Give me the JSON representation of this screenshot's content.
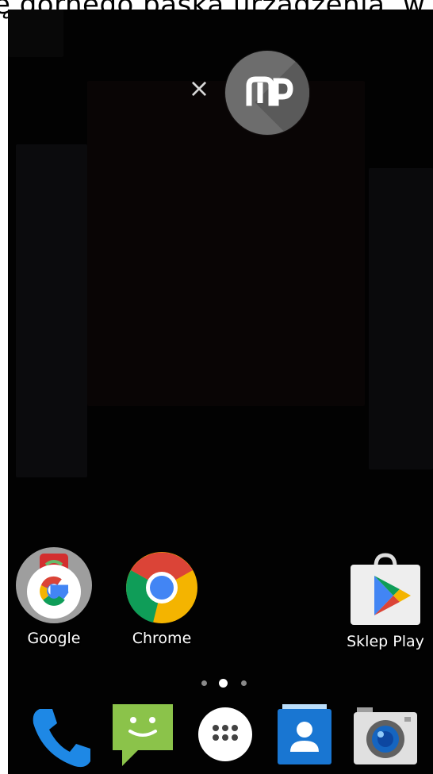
{
  "banner": {
    "text": "ę górnego paska urządzenia, w mie"
  },
  "bubble": {
    "close_glyph": "×",
    "icon": "app-logo-icon"
  },
  "home_apps": [
    {
      "label": "Google",
      "icon": "google-folder-icon"
    },
    {
      "label": "Chrome",
      "icon": "chrome-icon"
    },
    {
      "label": "Sklep Play",
      "icon": "play-store-icon"
    }
  ],
  "page_indicator": {
    "pages": 3,
    "current": 2
  },
  "dock": [
    {
      "name": "phone-icon"
    },
    {
      "name": "messaging-icon"
    },
    {
      "name": "app-drawer-icon"
    },
    {
      "name": "contacts-icon"
    },
    {
      "name": "camera-icon"
    }
  ],
  "colors": {
    "background": "#020202",
    "chrome_red": "#DB4437",
    "chrome_green": "#0F9D58",
    "chrome_yellow": "#F4B400",
    "chrome_blue": "#4285F4",
    "phone_blue": "#1E88E5",
    "messaging_green": "#8BC34A",
    "contacts_blue": "#1976D2"
  }
}
